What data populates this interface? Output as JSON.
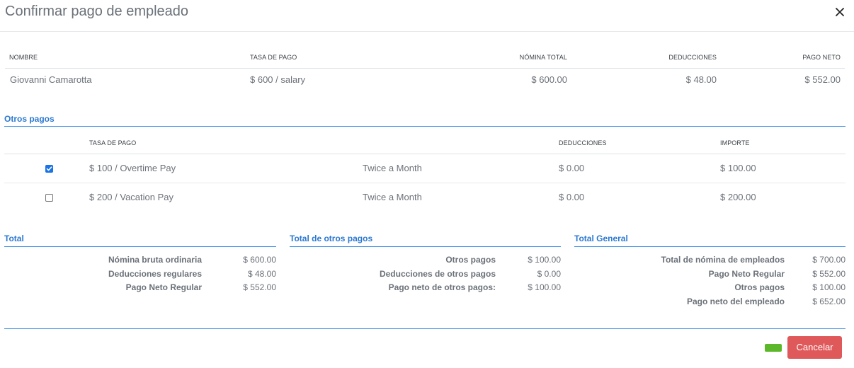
{
  "dialog": {
    "title": "Confirmar pago de empleado"
  },
  "employee_table": {
    "headers": {
      "name": "NOMBRE",
      "rate": "TASA DE PAGO",
      "gross": "NÓMINA TOTAL",
      "deductions": "DEDUCCIONES",
      "net": "PAGO NETO"
    },
    "row": {
      "name": "Giovanni Camarotta",
      "rate": "$ 600 / salary",
      "gross": "$ 600.00",
      "deductions": "$ 48.00",
      "net": "$ 552.00"
    }
  },
  "other_payments": {
    "title": "Otros pagos",
    "headers": {
      "rate": "TASA DE PAGO",
      "deductions": "DEDUCCIONES",
      "amount": "IMPORTE"
    },
    "rows": [
      {
        "checked": true,
        "rate": "$ 100 / Overtime Pay",
        "frequency": "Twice a Month",
        "deductions": "$ 0.00",
        "amount": "$ 100.00"
      },
      {
        "checked": false,
        "rate": "$ 200 / Vacation Pay",
        "frequency": "Twice a Month",
        "deductions": "$ 0.00",
        "amount": "$ 200.00"
      }
    ]
  },
  "summary": {
    "total": {
      "title": "Total",
      "rows": [
        {
          "label": "Nómina bruta ordinaria",
          "value": "$ 600.00"
        },
        {
          "label": "Deducciones regulares",
          "value": "$ 48.00"
        },
        {
          "label": "Pago Neto Regular",
          "value": "$ 552.00"
        }
      ]
    },
    "other_total": {
      "title": "Total de otros pagos",
      "rows": [
        {
          "label": "Otros pagos",
          "value": "$ 100.00"
        },
        {
          "label": "Deducciones de otros pagos",
          "value": "$ 0.00"
        },
        {
          "label": "Pago neto de otros pagos:",
          "value": "$ 100.00"
        }
      ]
    },
    "grand_total": {
      "title": "Total General",
      "rows": [
        {
          "label": "Total de nómina de empleados",
          "value": "$ 700.00"
        },
        {
          "label": "Pago Neto Regular",
          "value": "$ 552.00"
        },
        {
          "label": "Otros pagos",
          "value": "$ 100.00"
        },
        {
          "label": "Pago neto del empleado",
          "value": "$ 652.00"
        }
      ]
    }
  },
  "footer": {
    "cancel_label": "Cancelar"
  },
  "colors": {
    "accent": "#2b78d0",
    "confirm": "#5cb82a",
    "cancel": "#e0595a"
  },
  "icons": {
    "close": "close-icon",
    "check": "check-icon"
  }
}
